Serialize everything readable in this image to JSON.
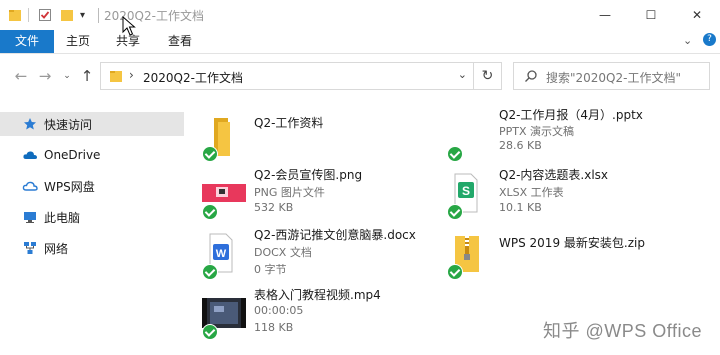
{
  "window": {
    "title": "2020Q2-工作文档",
    "controls": {
      "minimize": "—",
      "maximize": "☐",
      "close": "✕"
    }
  },
  "ribbon": {
    "tabs": [
      "文件",
      "主页",
      "共享",
      "查看"
    ],
    "collapse_glyph": "⌄",
    "help_glyph": "?"
  },
  "address": {
    "path": "2020Q2-工作文档",
    "search_placeholder": "搜索\"2020Q2-工作文档\""
  },
  "sidebar": {
    "items": [
      {
        "label": "快速访问",
        "icon": "star-icon",
        "selected": true
      },
      {
        "label": "OneDrive",
        "icon": "cloud-icon"
      },
      {
        "label": "WPS网盘",
        "icon": "wps-cloud-icon"
      },
      {
        "label": "此电脑",
        "icon": "computer-icon"
      },
      {
        "label": "网络",
        "icon": "network-icon"
      }
    ]
  },
  "files": [
    {
      "name": "Q2-工作资料",
      "line2": "",
      "line3": "",
      "type": "folder"
    },
    {
      "name": "Q2-工作月报（4月）.pptx",
      "line2": "PPTX 演示文稿",
      "line3": "28.6 KB",
      "type": "pptx"
    },
    {
      "name": "Q2-会员宣传图.png",
      "line2": "PNG 图片文件",
      "line3": "532 KB",
      "type": "png"
    },
    {
      "name": "Q2-内容选题表.xlsx",
      "line2": "XLSX 工作表",
      "line3": "10.1 KB",
      "type": "xlsx"
    },
    {
      "name": "Q2-西游记推文创意脑暴.docx",
      "line2": "DOCX 文档",
      "line3": "0 字节",
      "type": "docx"
    },
    {
      "name": "WPS 2019 最新安装包.zip",
      "line2": "",
      "line3": "",
      "type": "zip"
    },
    {
      "name": "表格入门教程视频.mp4",
      "line2": "00:00:05",
      "line3": "118 KB",
      "type": "mp4"
    }
  ],
  "watermark": "知乎 @WPS Office",
  "colors": {
    "accent": "#1979ca",
    "sync_ok": "#28a745",
    "folder": "#f5c542"
  }
}
